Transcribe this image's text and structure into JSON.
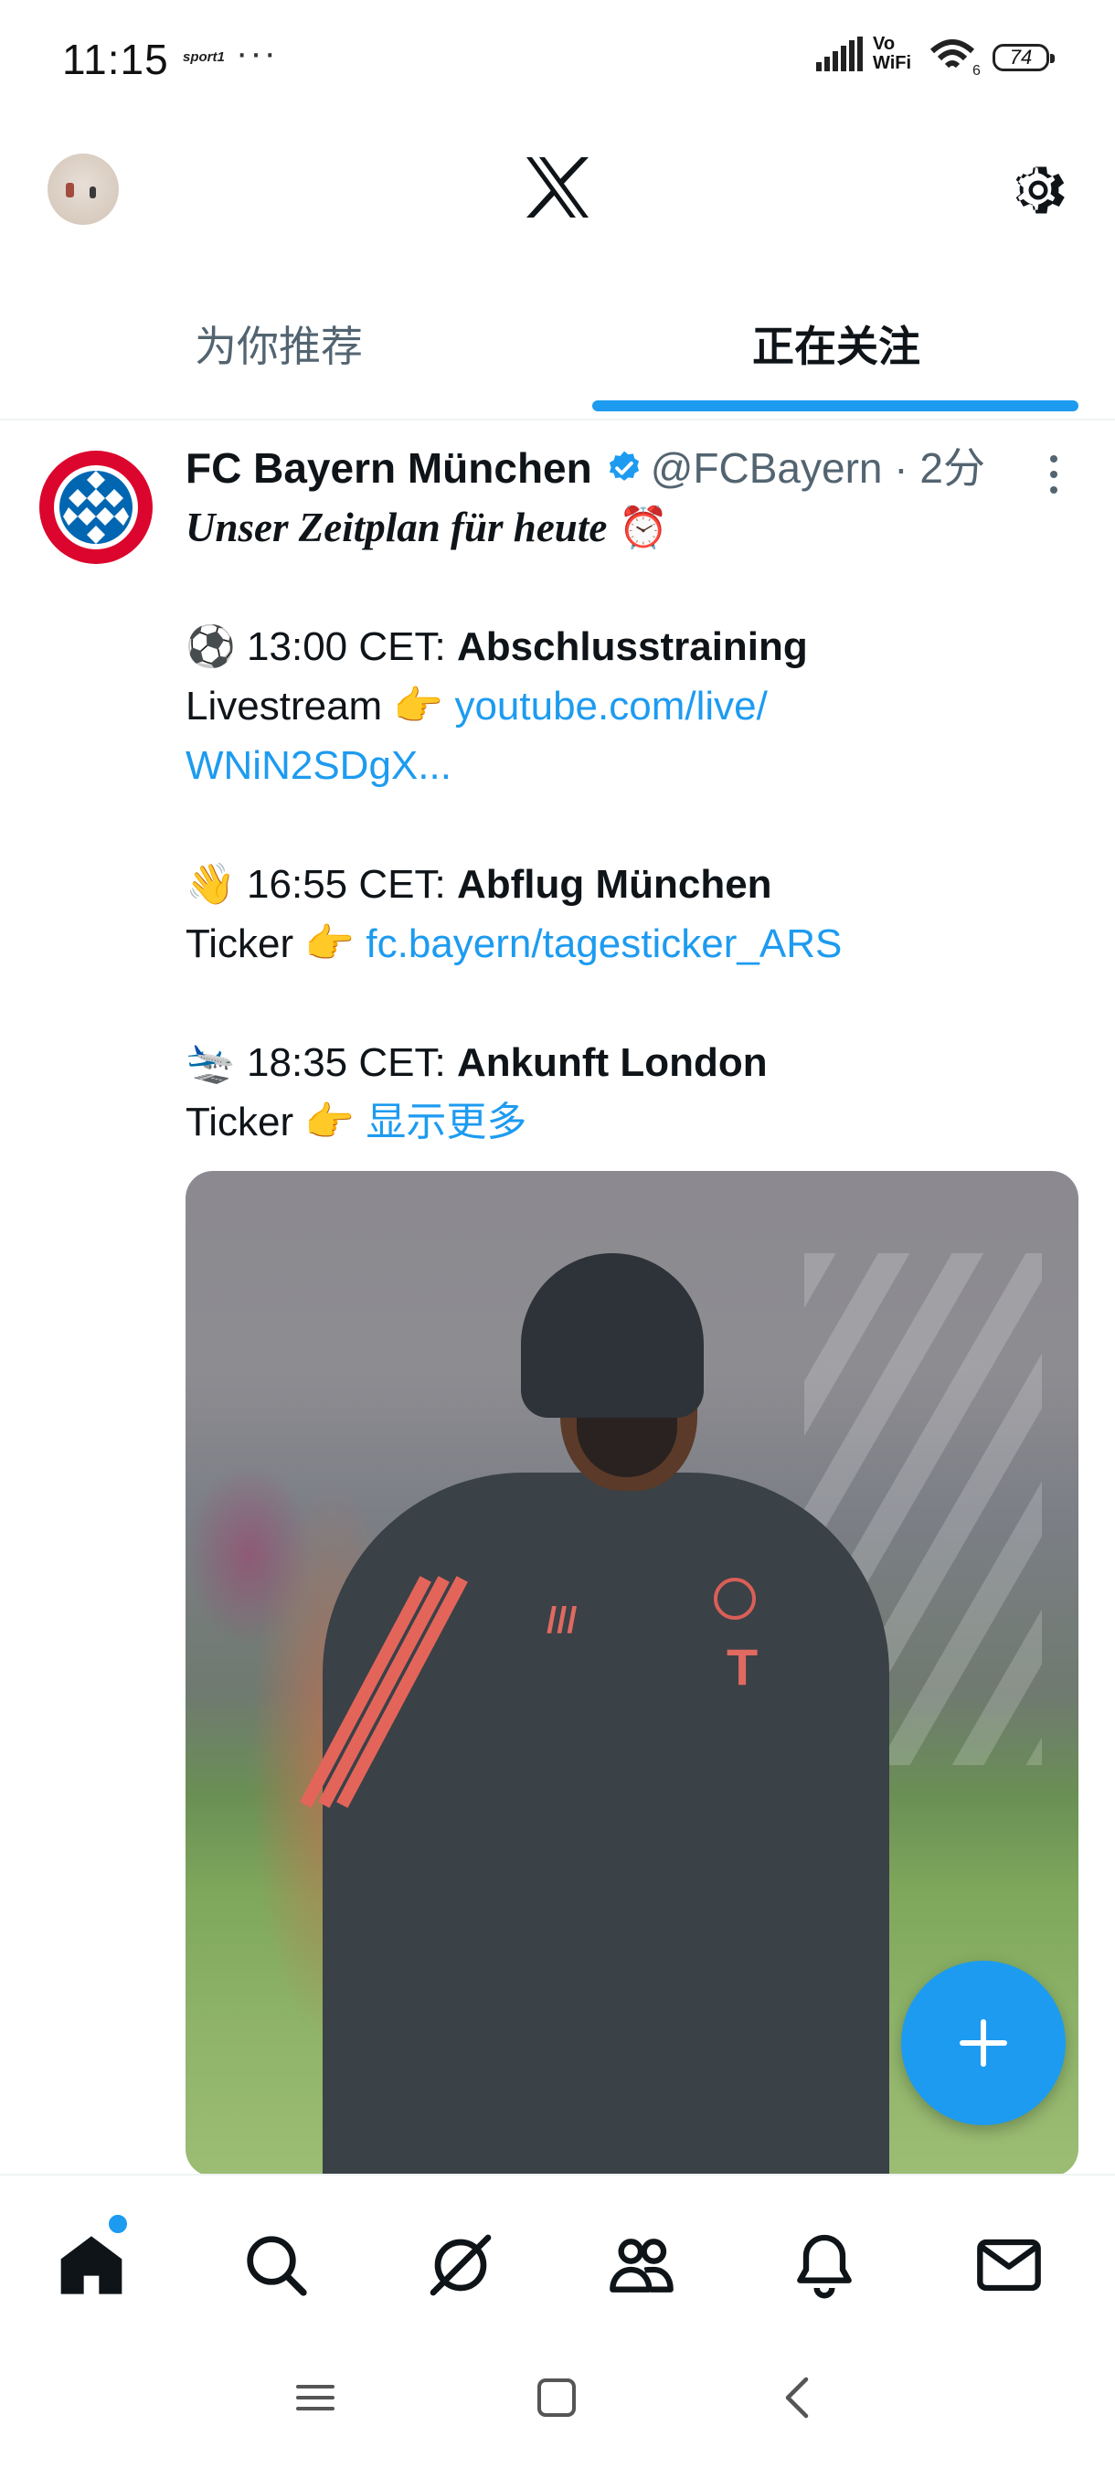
{
  "status_bar": {
    "time": "11:15",
    "notification_app": "sport1",
    "more": "···",
    "vowifi_top": "Vo",
    "vowifi_bottom": "WiFi",
    "wifi_label": "6",
    "battery": "74"
  },
  "header": {
    "logo_icon": "x-logo-icon",
    "settings_icon": "gear-icon"
  },
  "tabs": [
    {
      "label": "为你推荐",
      "active": false
    },
    {
      "label": "正在关注",
      "active": true
    }
  ],
  "tweet": {
    "author_name": "FC Bayern München",
    "handle": "@FCBayern",
    "dot": "·",
    "time": "2分",
    "headline": "Unser Zeitplan für heute",
    "headline_emoji": "⏰",
    "line1_emoji": "⚽",
    "line1_time": " 13:00 CET: ",
    "line1_bold": "Abschlusstraining",
    "line2_text": "Livestream ",
    "pointer_emoji": "👉",
    "line2_link_a": "youtube.com/live/",
    "line2_link_b": "WNiN2SDgX...",
    "line3_emoji": "👋",
    "line3_time": " 16:55 CET: ",
    "line3_bold": "Abflug München",
    "ticker_label": "Ticker ",
    "line4_link": "fc.bayern/tagesticker_ARS",
    "line5_emoji": "🛬",
    "line5_time": " 18:35 CET: ",
    "line5_bold": "Ankunft London",
    "show_more": "显示更多"
  },
  "colors": {
    "accent": "#1d9bf0",
    "text_primary": "#0f1419",
    "text_secondary": "#536471"
  },
  "bottom_nav": [
    "home-icon",
    "search-icon",
    "grok-icon",
    "communities-icon",
    "notifications-bell-icon",
    "messages-envelope-icon"
  ],
  "system_nav": [
    "recents-menu-icon",
    "home-square-icon",
    "back-chevron-icon"
  ]
}
